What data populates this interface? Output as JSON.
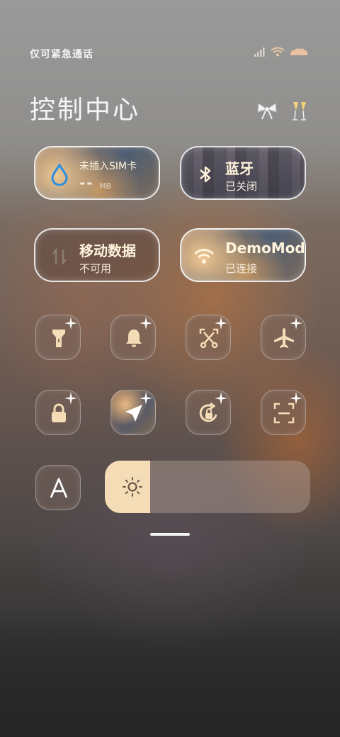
{
  "status_bar": {
    "carrier_text": "仅可紧急通话",
    "icons": [
      "signal-icon",
      "wifi-icon",
      "battery-icon"
    ]
  },
  "header": {
    "title": "控制中心",
    "icons": [
      "bow-icon",
      "champagne-icon"
    ]
  },
  "tiles": {
    "sim": {
      "title": "未插入SIM卡",
      "value": "--",
      "unit": "MB",
      "icon": "water-drop-icon"
    },
    "bluetooth": {
      "title": "蓝牙",
      "status": "已关闭",
      "icon": "bluetooth-icon"
    },
    "mobile_data": {
      "title": "移动数据",
      "status": "不可用",
      "icon": "data-arrows-icon"
    },
    "wifi": {
      "title": "DemoMod",
      "status": "已连接",
      "icon": "wifi-icon"
    }
  },
  "toggles": [
    {
      "name": "flashlight",
      "icon": "flashlight-icon"
    },
    {
      "name": "ringer",
      "icon": "bell-icon"
    },
    {
      "name": "screenshot",
      "icon": "scissors-icon"
    },
    {
      "name": "airplane",
      "icon": "airplane-icon"
    },
    {
      "name": "lock",
      "icon": "lock-icon"
    },
    {
      "name": "location",
      "icon": "location-arrow-icon"
    },
    {
      "name": "rotation-lock",
      "icon": "rotation-lock-icon"
    },
    {
      "name": "scanner",
      "icon": "scan-icon"
    },
    {
      "name": "auto-brightness",
      "icon": "letter-a-icon"
    }
  ],
  "brightness": {
    "level": 0.22,
    "icon": "sun-icon"
  },
  "colors": {
    "accent": "#f4dcb7",
    "text": "#fff3dc"
  }
}
